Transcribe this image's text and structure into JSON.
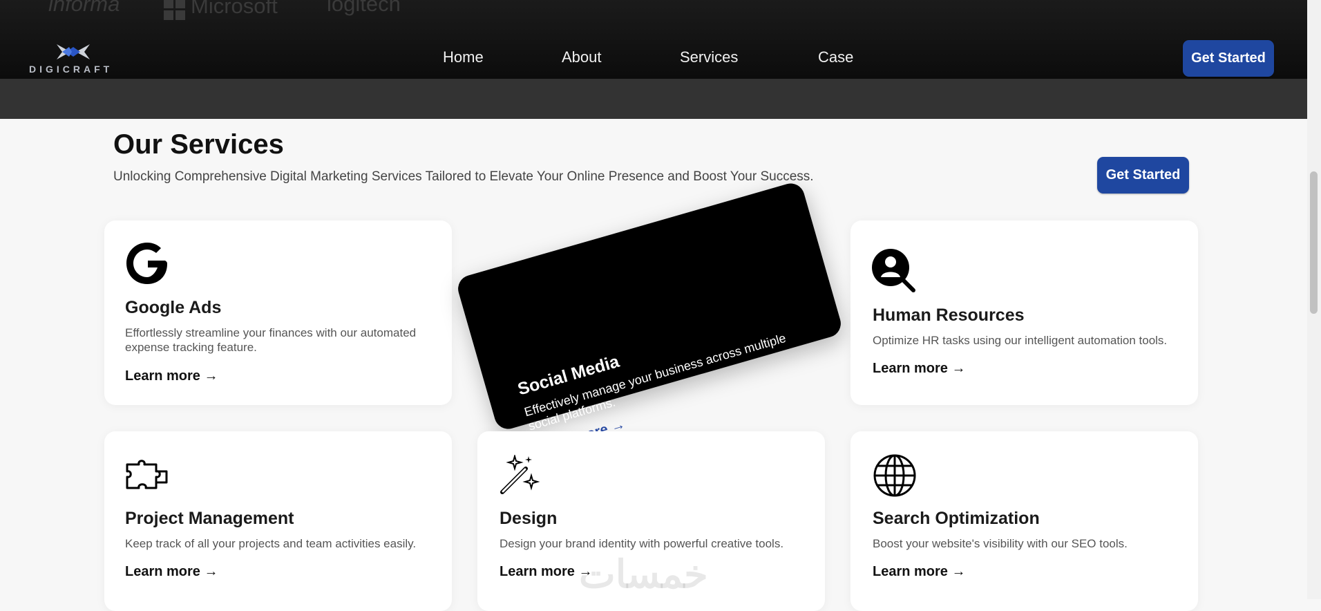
{
  "header": {
    "partners": [
      "informa",
      "Microsoft",
      "logitech"
    ],
    "logo_text": "DIGICRAFT",
    "nav": [
      "Home",
      "About",
      "Services",
      "Case"
    ],
    "cta_label": "Get Started"
  },
  "services": {
    "title": "Our Services",
    "subtitle": "Unlocking Comprehensive Digital Marketing Services Tailored to Elevate Your Online Presence and Boost Your Success.",
    "cta_label": "Get Started",
    "cards": [
      {
        "icon": "google-icon",
        "title": "Google Ads",
        "desc": "Effortlessly streamline your finances with our automated expense tracking feature.",
        "link": "Learn more →"
      },
      {
        "icon": "social-media",
        "title": "Social Media",
        "desc": "Effectively manage your business across multiple social platforms.",
        "link": "Learn more →"
      },
      {
        "icon": "user-search-icon",
        "title": "Human Resources",
        "desc": "Optimize HR tasks using our intelligent automation tools.",
        "link": "Learn more →"
      },
      {
        "icon": "puzzle-icon",
        "title": "Project Management",
        "desc": "Keep track of all your projects and team activities easily.",
        "link": "Learn more →"
      },
      {
        "icon": "magic-wand-icon",
        "title": "Design",
        "desc": "Design your brand identity with powerful creative tools.",
        "link": "Learn more →"
      },
      {
        "icon": "globe-icon",
        "title": "Search Optimization",
        "desc": "Boost your website's visibility with our SEO tools.",
        "link": "Learn more →"
      }
    ]
  },
  "watermark": "خمسات",
  "colors": {
    "accent": "#1f47a0",
    "header_bg": "#0c0c0c",
    "page_bg": "#f7f7f7"
  }
}
